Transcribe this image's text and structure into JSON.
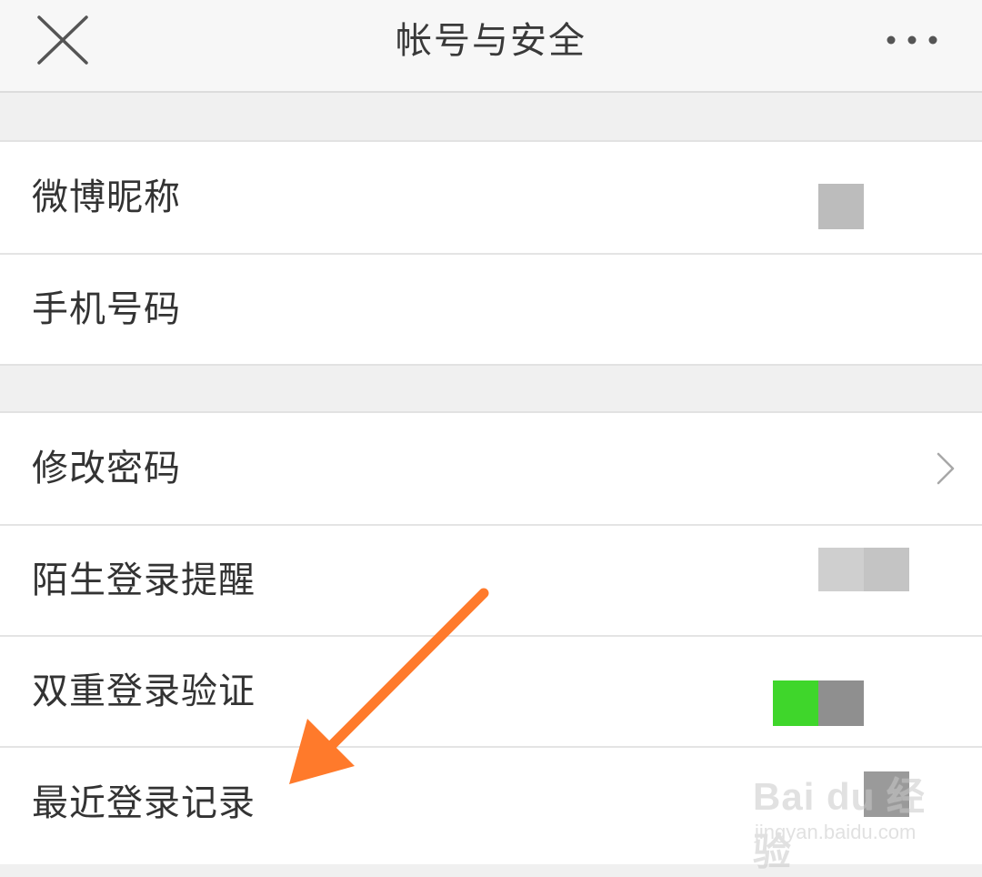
{
  "header": {
    "title": "帐号与安全",
    "close_icon": "close-icon",
    "more_icon": "more-horizontal-icon"
  },
  "groups": [
    {
      "items": [
        {
          "label": "微博昵称"
        },
        {
          "label": "手机号码"
        }
      ]
    },
    {
      "items": [
        {
          "label": "修改密码",
          "icon": "chevron-right-icon"
        },
        {
          "label": "陌生登录提醒"
        },
        {
          "label": "双重登录验证",
          "toggle": "on"
        },
        {
          "label": "最近登录记录"
        }
      ]
    }
  ],
  "watermark": {
    "logo": "Bai du 经验",
    "url": "jingyan.baidu.com"
  },
  "colors": {
    "background": "#f0f0f0",
    "nav_background": "#f7f7f7",
    "row_background": "#ffffff",
    "text": "#333333",
    "toggle_on": "#3fd62b",
    "annotation_arrow": "#ff7a2b"
  }
}
